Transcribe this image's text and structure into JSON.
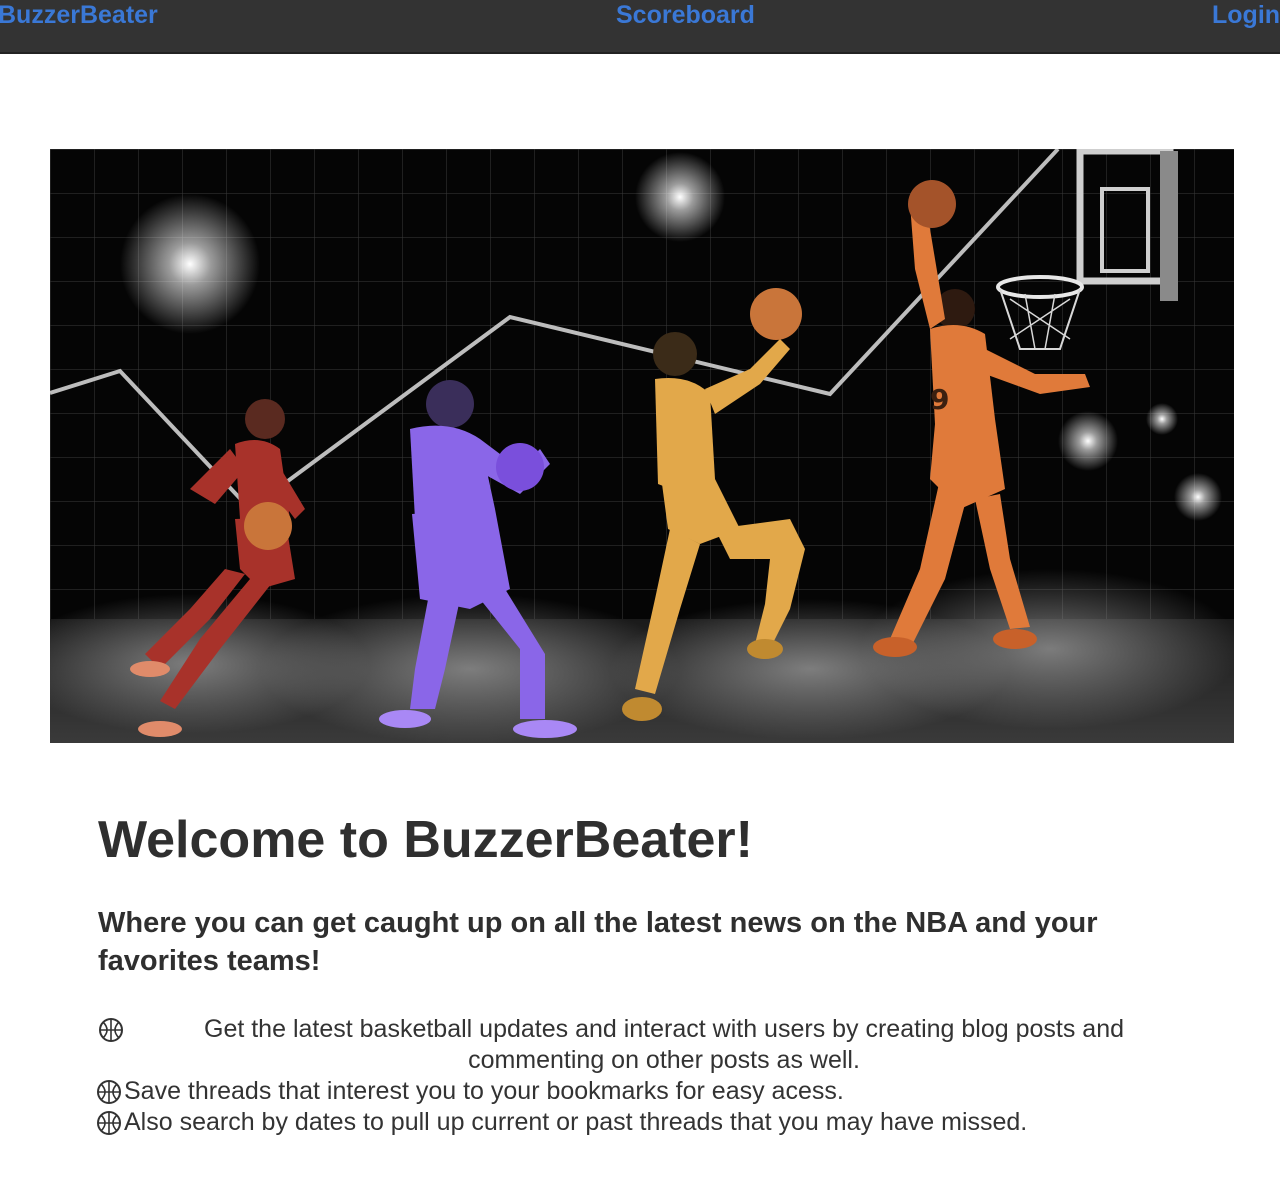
{
  "nav": {
    "brand": "BuzzerBeater",
    "scoreboard": "Scoreboard",
    "login": "Login"
  },
  "hero": {
    "icon": "basketball-players-banner",
    "jersey_number": "9",
    "colors": {
      "background": "#050505",
      "player_red": "#a8322a",
      "player_purple": "#8a66e8",
      "player_gold": "#e2a84a",
      "player_orange": "#e07a3a",
      "ball": "#c9753a"
    }
  },
  "content": {
    "welcome": "Welcome to BuzzerBeater!",
    "tagline": "Where you can get caught up on all the latest news on the NBA and your favorites teams!",
    "features": [
      "Get the latest basketball updates and interact with users by creating blog posts and commenting on other posts as well.",
      "Save threads that interest you to your bookmarks for easy acess.",
      "Also search by dates to pull up current or past threads that you may have missed."
    ],
    "bullet_icon": "basketball-icon"
  },
  "colors": {
    "navbar": "#333333",
    "nav_link": "#3a78d6",
    "text": "#2f2f2f"
  }
}
